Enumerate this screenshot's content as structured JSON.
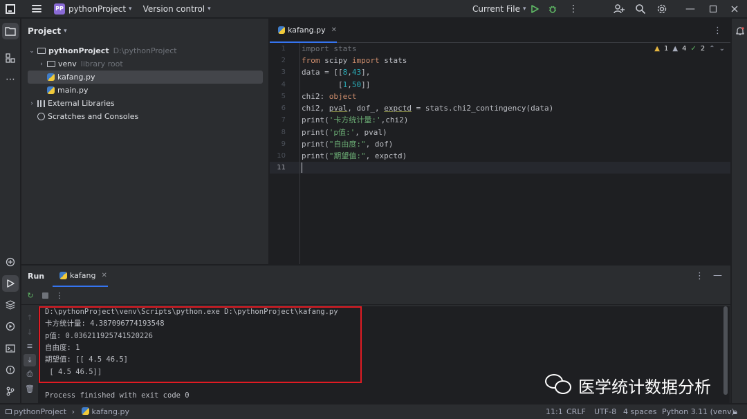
{
  "titlebar": {
    "project_badge": "PP",
    "project_name": "pythonProject",
    "vcs": "Version control",
    "run_config": "Current File"
  },
  "project_panel": {
    "title": "Project",
    "tree": [
      {
        "label": "pythonProject",
        "hint": "D:\\pythonProject",
        "type": "folder",
        "expanded": true
      },
      {
        "label": "venv",
        "hint": "library root",
        "type": "folder",
        "expanded": false
      },
      {
        "label": "kafang.py",
        "type": "python",
        "selected": true
      },
      {
        "label": "main.py",
        "type": "python"
      },
      {
        "label": "External Libraries",
        "type": "library",
        "expanded": false
      },
      {
        "label": "Scratches and Consoles",
        "type": "scratch"
      }
    ]
  },
  "editor": {
    "tab_label": "kafang.py",
    "inspections": {
      "warnings": "1",
      "weak_warnings": "4",
      "ok": "2"
    },
    "line_numbers": [
      "1",
      "2",
      "3",
      "4",
      "5",
      "6",
      "7",
      "8",
      "9",
      "10",
      "11"
    ],
    "current_line": "11",
    "code": {
      "l1": "import stats",
      "l2_a": "from",
      "l2_b": " scipy ",
      "l2_c": "import",
      "l2_d": " stats",
      "l3_a": "data = [[",
      "l3_b": "8",
      "l3_c": ",",
      "l3_d": "43",
      "l3_e": "],",
      "l4_a": "        [",
      "l4_b": "1",
      "l4_c": ",",
      "l4_d": "50",
      "l4_e": "]]",
      "l5_a": "chi2: ",
      "l5_b": "object",
      "l6_a": "chi2, ",
      "l6_b": "pval",
      "l6_c": ", dof_, ",
      "l6_d": "expctd",
      "l6_e": " = stats.chi2_contingency(data)",
      "l7_a": "print(",
      "l7_b": "'卡方统计量:'",
      "l7_c": ",chi2)",
      "l8_a": "print(",
      "l8_b": "'p值:'",
      "l8_c": ", pval)",
      "l9_a": "print(",
      "l9_b": "\"自由度:\"",
      "l9_c": ", dof)",
      "l10_a": "print(",
      "l10_b": "\"期望值:\"",
      "l10_c": ", expctd)"
    }
  },
  "run_panel": {
    "title": "Run",
    "tab_label": "kafang",
    "console": [
      "D:\\pythonProject\\venv\\Scripts\\python.exe D:\\pythonProject\\kafang.py",
      "卡方统计量: 4.387096774193548",
      "p值: 0.036211925741520226",
      "自由度: 1",
      "期望值: [[ 4.5 46.5]",
      " [ 4.5 46.5]]",
      "",
      "Process finished with exit code 0"
    ]
  },
  "watermark": {
    "text": "医学统计数据分析"
  },
  "statusbar": {
    "breadcrumb_project": "pythonProject",
    "breadcrumb_file": "kafang.py",
    "position": "11:1",
    "line_sep": "CRLF",
    "encoding": "UTF-8",
    "indent": "4 spaces",
    "interpreter": "Python 3.11 (venv)"
  }
}
